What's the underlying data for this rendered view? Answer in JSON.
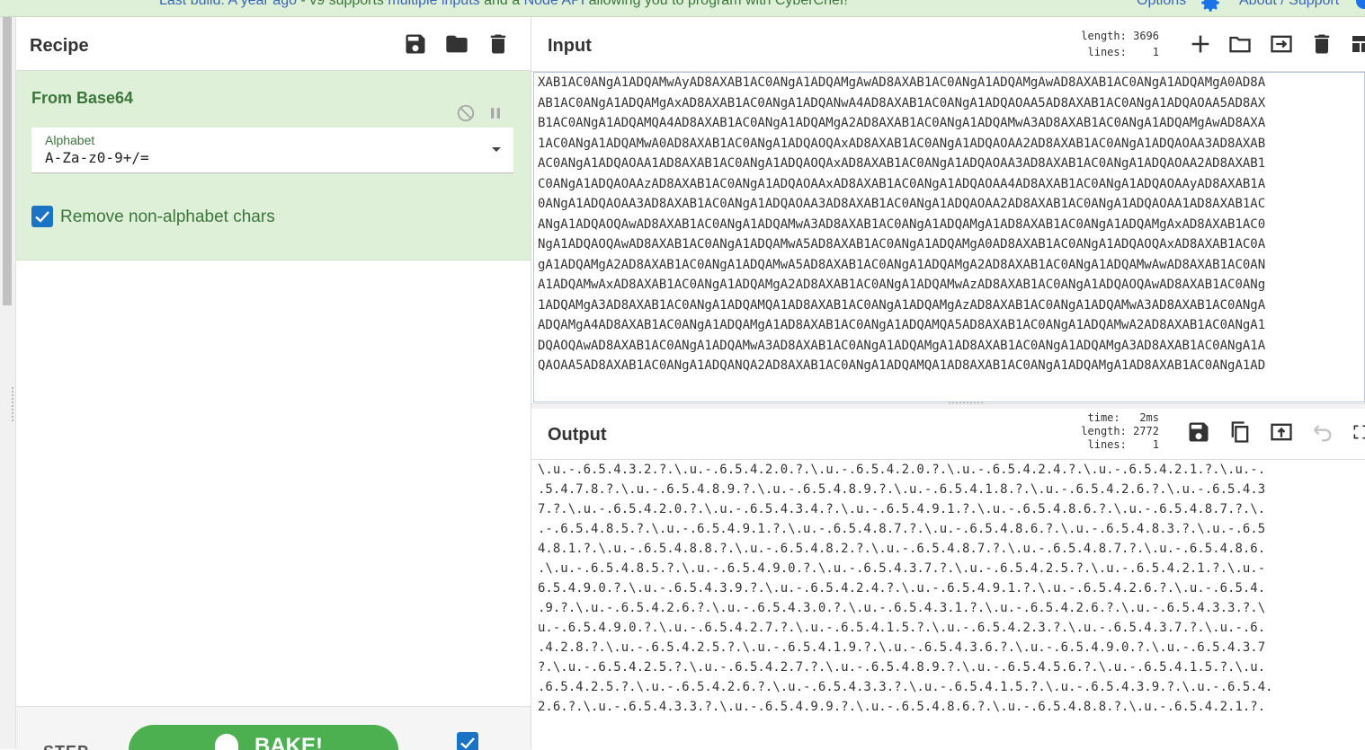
{
  "banner": {
    "link_text": "Last build: A year ago",
    "separator": " - v9 supports ",
    "link2": "multiple inputs",
    "mid": " and a ",
    "link3": "Node API",
    "end": " allowing you to program with CyberChef!",
    "options_label": "Options",
    "about_label": "About / Support"
  },
  "recipe": {
    "title": "Recipe",
    "operation": {
      "name": "From Base64",
      "alphabet_label": "Alphabet",
      "alphabet_value": "A-Za-z0-9+/=",
      "remove_label": "Remove non-alphabet chars"
    },
    "step_label": "STEP",
    "bake_label": "BAKE!"
  },
  "input": {
    "title": "Input",
    "stats_label_length": "length:",
    "stats_value_length": "3696",
    "stats_label_lines": "lines:",
    "stats_value_lines": "1",
    "lines": [
      "XAB1AC0ANgA1ADQAMwAyAD8AXAB1AC0ANgA1ADQAMgAwAD8AXAB1AC0ANgA1ADQAMgAwAD8AXAB1AC0ANgA1ADQAMgA0AD8A",
      "AB1AC0ANgA1ADQAMgAxAD8AXAB1AC0ANgA1ADQANwA4AD8AXAB1AC0ANgA1ADQAOAA5AD8AXAB1AC0ANgA1ADQAOAA5AD8AX",
      "B1AC0ANgA1ADQAMQA4AD8AXAB1AC0ANgA1ADQAMgA2AD8AXAB1AC0ANgA1ADQAMwA3AD8AXAB1AC0ANgA1ADQAMgAwAD8AXA",
      "1AC0ANgA1ADQAMwA0AD8AXAB1AC0ANgA1ADQAOQAxAD8AXAB1AC0ANgA1ADQAOAA2AD8AXAB1AC0ANgA1ADQAOAA3AD8AXAB",
      "AC0ANgA1ADQAOAA1AD8AXAB1AC0ANgA1ADQAOQAxAD8AXAB1AC0ANgA1ADQAOAA3AD8AXAB1AC0ANgA1ADQAOAA2AD8AXAB1",
      "C0ANgA1ADQAOAAzAD8AXAB1AC0ANgA1ADQAOAAxAD8AXAB1AC0ANgA1ADQAOAA4AD8AXAB1AC0ANgA1ADQAOAAyAD8AXAB1A",
      "0ANgA1ADQAOAA3AD8AXAB1AC0ANgA1ADQAOAA3AD8AXAB1AC0ANgA1ADQAOAA2AD8AXAB1AC0ANgA1ADQAOAA1AD8AXAB1AC",
      "ANgA1ADQAOQAwAD8AXAB1AC0ANgA1ADQAMwA3AD8AXAB1AC0ANgA1ADQAMgA1AD8AXAB1AC0ANgA1ADQAMgAxAD8AXAB1AC0",
      "NgA1ADQAOQAwAD8AXAB1AC0ANgA1ADQAMwA5AD8AXAB1AC0ANgA1ADQAMgA0AD8AXAB1AC0ANgA1ADQAOQAxAD8AXAB1AC0A",
      "gA1ADQAMgA2AD8AXAB1AC0ANgA1ADQAMwA5AD8AXAB1AC0ANgA1ADQAMgA2AD8AXAB1AC0ANgA1ADQAMwAwAD8AXAB1AC0AN",
      "A1ADQAMwAxAD8AXAB1AC0ANgA1ADQAMgA2AD8AXAB1AC0ANgA1ADQAMwAzAD8AXAB1AC0ANgA1ADQAOQAwAD8AXAB1AC0ANg",
      "1ADQAMgA3AD8AXAB1AC0ANgA1ADQAMQA1AD8AXAB1AC0ANgA1ADQAMgAzAD8AXAB1AC0ANgA1ADQAMwA3AD8AXAB1AC0ANgA",
      "ADQAMgA4AD8AXAB1AC0ANgA1ADQAMgA1AD8AXAB1AC0ANgA1ADQAMQA5AD8AXAB1AC0ANgA1ADQAMwA2AD8AXAB1AC0ANgA1",
      "DQAOQAwAD8AXAB1AC0ANgA1ADQAMwA3AD8AXAB1AC0ANgA1ADQAMgA1AD8AXAB1AC0ANgA1ADQAMgA3AD8AXAB1AC0ANgA1A",
      "QAOAA5AD8AXAB1AC0ANgA1ADQANQA2AD8AXAB1AC0ANgA1ADQAMQA1AD8AXAB1AC0ANgA1ADQAMgA1AD8AXAB1AC0ANgA1AD"
    ]
  },
  "output": {
    "title": "Output",
    "stats_label_time": "time:",
    "stats_value_time": "2ms",
    "stats_label_length": "length:",
    "stats_value_length": "2772",
    "stats_label_lines": "lines:",
    "stats_value_lines": "1",
    "lines": [
      "\\.u.-.6.5.4.3.2.?.\\.u.-.6.5.4.2.0.?.\\.u.-.6.5.4.2.0.?.\\.u.-.6.5.4.2.4.?.\\.u.-.6.5.4.2.1.?.\\.u.-.",
      ".5.4.7.8.?.\\.u.-.6.5.4.8.9.?.\\.u.-.6.5.4.8.9.?.\\.u.-.6.5.4.1.8.?.\\.u.-.6.5.4.2.6.?.\\.u.-.6.5.4.3",
      "7.?.\\.u.-.6.5.4.2.0.?.\\.u.-.6.5.4.3.4.?.\\.u.-.6.5.4.9.1.?.\\.u.-.6.5.4.8.6.?.\\.u.-.6.5.4.8.7.?.\\.",
      ".-.6.5.4.8.5.?.\\.u.-.6.5.4.9.1.?.\\.u.-.6.5.4.8.7.?.\\.u.-.6.5.4.8.6.?.\\.u.-.6.5.4.8.3.?.\\.u.-.6.5",
      "4.8.1.?.\\.u.-.6.5.4.8.8.?.\\.u.-.6.5.4.8.2.?.\\.u.-.6.5.4.8.7.?.\\.u.-.6.5.4.8.7.?.\\.u.-.6.5.4.8.6.",
      ".\\.u.-.6.5.4.8.5.?.\\.u.-.6.5.4.9.0.?.\\.u.-.6.5.4.3.7.?.\\.u.-.6.5.4.2.5.?.\\.u.-.6.5.4.2.1.?.\\.u.-",
      "6.5.4.9.0.?.\\.u.-.6.5.4.3.9.?.\\.u.-.6.5.4.2.4.?.\\.u.-.6.5.4.9.1.?.\\.u.-.6.5.4.2.6.?.\\.u.-.6.5.4.",
      ".9.?.\\.u.-.6.5.4.2.6.?.\\.u.-.6.5.4.3.0.?.\\.u.-.6.5.4.3.1.?.\\.u.-.6.5.4.2.6.?.\\.u.-.6.5.4.3.3.?.\\",
      "u.-.6.5.4.9.0.?.\\.u.-.6.5.4.2.7.?.\\.u.-.6.5.4.1.5.?.\\.u.-.6.5.4.2.3.?.\\.u.-.6.5.4.3.7.?.\\.u.-.6.",
      ".4.2.8.?.\\.u.-.6.5.4.2.5.?.\\.u.-.6.5.4.1.9.?.\\.u.-.6.5.4.3.6.?.\\.u.-.6.5.4.9.0.?.\\.u.-.6.5.4.3.7",
      "?.\\.u.-.6.5.4.2.5.?.\\.u.-.6.5.4.2.7.?.\\.u.-.6.5.4.8.9.?.\\.u.-.6.5.4.5.6.?.\\.u.-.6.5.4.1.5.?.\\.u.",
      ".6.5.4.2.5.?.\\.u.-.6.5.4.2.6.?.\\.u.-.6.5.4.3.3.?.\\.u.-.6.5.4.1.5.?.\\.u.-.6.5.4.3.9.?.\\.u.-.6.5.4.",
      "2.6.?.\\.u.-.6.5.4.3.3.?.\\.u.-.6.5.4.9.9.?.\\.u.-.6.5.4.8.6.?.\\.u.-.6.5.4.8.8.?.\\.u.-.6.5.4.2.1.?."
    ]
  },
  "colors": {
    "accent_green": "#3c763d",
    "op_background": "#dff0d8",
    "checkbox_blue": "#1a73c4",
    "bake_green": "#4caf50"
  },
  "icons": {
    "recipe_toolbar": [
      "save-icon",
      "folder-icon",
      "trash-icon"
    ],
    "operation": [
      "disable-icon",
      "pause-icon"
    ],
    "input_toolbar": [
      "plus-icon",
      "folder-icon",
      "import-icon",
      "trash-icon",
      "layout-icon"
    ],
    "output_toolbar": [
      "save-icon",
      "copy-icon",
      "export-icon",
      "undo-icon",
      "maximise-icon"
    ]
  }
}
